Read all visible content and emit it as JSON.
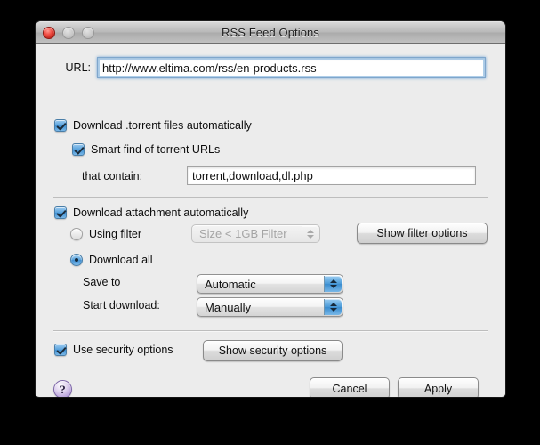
{
  "window": {
    "title": "RSS Feed Options",
    "traffic_lights": {
      "close": "close-button",
      "minimize": "minimize-button",
      "zoom": "zoom-button"
    }
  },
  "url_row": {
    "label": "URL:",
    "value": "http://www.eltima.com/rss/en-products.rss",
    "placeholder": "http://"
  },
  "torrent_section": {
    "download_torrent": {
      "label": "Download .torrent files automatically",
      "checked": true
    },
    "smart_find": {
      "label": "Smart find of torrent URLs",
      "checked": true
    },
    "that_contain": {
      "label": "that contain:",
      "value": "torrent,download,dl.php",
      "placeholder": ""
    }
  },
  "attachment_section": {
    "download_attachment": {
      "label": "Download attachment automatically",
      "checked": true
    },
    "using_filter": {
      "label": "Using filter",
      "selected": false
    },
    "filter_popup": {
      "value": "Size < 1GB Filter",
      "enabled": false
    },
    "show_filter_options_label": "Show filter options",
    "download_all": {
      "label": "Download all",
      "selected": true
    },
    "save_to": {
      "label": "Save to",
      "value": "Automatic"
    },
    "start_download": {
      "label": "Start download:",
      "value": "Manually"
    }
  },
  "security_section": {
    "use_security_options": {
      "label": "Use security options",
      "checked": true
    },
    "show_security_options_label": "Show security options"
  },
  "footer": {
    "help_glyph": "?",
    "cancel_label": "Cancel",
    "apply_label": "Apply"
  },
  "colors": {
    "accent_blue": "#4d9cd9",
    "window_bg": "#ececec",
    "help_purple": "#bda7dd",
    "close_red": "#ef4b41"
  }
}
